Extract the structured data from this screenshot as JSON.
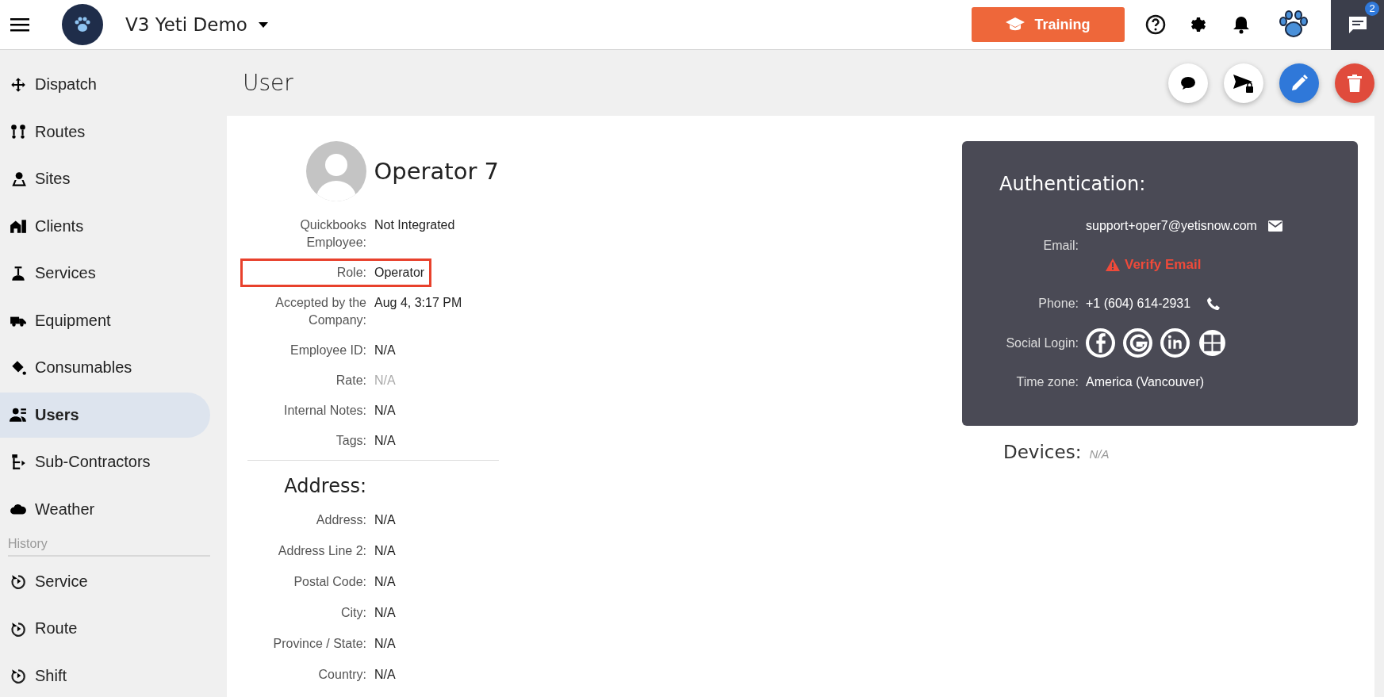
{
  "topbar": {
    "title": "V3 Yeti Demo",
    "training_button": "Training",
    "chat_badge": "2"
  },
  "sidebar": {
    "items": [
      {
        "label": "Dispatch",
        "selected": false
      },
      {
        "label": "Routes",
        "selected": false
      },
      {
        "label": "Sites",
        "selected": false
      },
      {
        "label": "Clients",
        "selected": false
      },
      {
        "label": "Services",
        "selected": false
      },
      {
        "label": "Equipment",
        "selected": false
      },
      {
        "label": "Consumables",
        "selected": false
      },
      {
        "label": "Users",
        "selected": true
      },
      {
        "label": "Sub-Contractors",
        "selected": false
      },
      {
        "label": "Weather",
        "selected": false
      }
    ],
    "history_label": "History",
    "history_items": [
      {
        "label": "Service",
        "selected": false
      },
      {
        "label": "Route",
        "selected": false
      },
      {
        "label": "Shift",
        "selected": false
      }
    ]
  },
  "page": {
    "title": "User"
  },
  "profile": {
    "name": "Operator 7",
    "fields": [
      {
        "label": "Quickbooks Employee:",
        "value": "Not Integrated",
        "highlighted": false,
        "muted": false
      },
      {
        "label": "Role:",
        "value": "Operator",
        "highlighted": true,
        "muted": false
      },
      {
        "label": "Accepted by the Company:",
        "value": "Aug 4, 3:17 PM",
        "highlighted": false,
        "muted": false
      },
      {
        "label": "Employee ID:",
        "value": "N/A",
        "highlighted": false,
        "muted": false
      },
      {
        "label": "Rate:",
        "value": "N/A",
        "highlighted": false,
        "muted": true
      },
      {
        "label": "Internal Notes:",
        "value": "N/A",
        "highlighted": false,
        "muted": false
      },
      {
        "label": "Tags:",
        "value": "N/A",
        "highlighted": false,
        "muted": false
      }
    ]
  },
  "address": {
    "title": "Address:",
    "fields": [
      {
        "label": "Address:",
        "value": "N/A"
      },
      {
        "label": "Address Line 2:",
        "value": "N/A"
      },
      {
        "label": "Postal Code:",
        "value": "N/A"
      },
      {
        "label": "City:",
        "value": "N/A"
      },
      {
        "label": "Province / State:",
        "value": "N/A"
      },
      {
        "label": "Country:",
        "value": "N/A"
      }
    ]
  },
  "auth": {
    "title": "Authentication:",
    "email_label": "Email:",
    "email": "support+oper7@yetisnow.com",
    "verify": "Verify Email",
    "phone_label": "Phone:",
    "phone": "+1 (604) 614-2931",
    "social_label": "Social Login:",
    "timezone_label": "Time zone:",
    "timezone": "America (Vancouver)"
  },
  "devices": {
    "label": "Devices:",
    "value": "N/A"
  }
}
